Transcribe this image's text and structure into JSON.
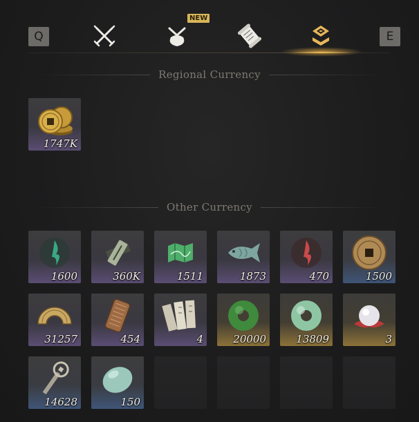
{
  "tabs": {
    "prev_key": "Q",
    "next_key": "E",
    "new_badge": "NEW",
    "items": [
      {
        "icon": "crossed-swords-icon",
        "active": false
      },
      {
        "icon": "bundle-icon",
        "active": false,
        "badge": "NEW"
      },
      {
        "icon": "scroll-icon",
        "active": false
      },
      {
        "icon": "currency-icon",
        "active": true
      }
    ],
    "accent_color": "#e8b75a"
  },
  "regional": {
    "title": "Regional Currency",
    "items": [
      {
        "icon": "gold-coins-icon",
        "count": "1747K",
        "rarity": "purple"
      }
    ]
  },
  "other": {
    "title": "Other Currency",
    "items": [
      {
        "icon": "jade-green-flame-icon",
        "count": "1600",
        "rarity": "purple"
      },
      {
        "icon": "bamboo-token-icon",
        "count": "360K",
        "rarity": "purple"
      },
      {
        "icon": "green-map-icon",
        "count": "1511",
        "rarity": "purple"
      },
      {
        "icon": "jade-fish-icon",
        "count": "1873",
        "rarity": "purple"
      },
      {
        "icon": "red-flame-icon",
        "count": "470",
        "rarity": "purple"
      },
      {
        "icon": "bronze-coin-icon",
        "count": "1500",
        "rarity": "blue"
      },
      {
        "icon": "half-coin-icon",
        "count": "31257",
        "rarity": "purple"
      },
      {
        "icon": "bronze-plaque-icon",
        "count": "454",
        "rarity": "purple"
      },
      {
        "icon": "paper-talismans-icon",
        "count": "4",
        "rarity": "purple"
      },
      {
        "icon": "green-jade-ring-icon",
        "count": "20000",
        "rarity": "gold"
      },
      {
        "icon": "pale-jade-ring-icon",
        "count": "13809",
        "rarity": "gold"
      },
      {
        "icon": "pearl-icon",
        "count": "3",
        "rarity": "gold"
      },
      {
        "icon": "coin-sword-icon",
        "count": "14628",
        "rarity": "blue"
      },
      {
        "icon": "jade-stone-icon",
        "count": "150",
        "rarity": "blue"
      }
    ]
  }
}
